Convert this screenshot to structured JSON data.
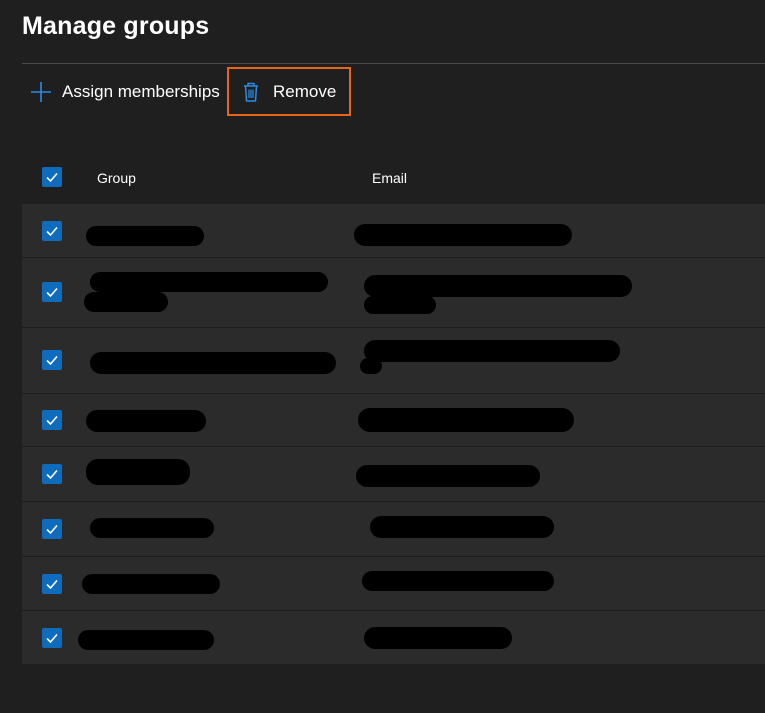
{
  "page": {
    "title": "Manage groups"
  },
  "toolbar": {
    "assign_label": "Assign memberships",
    "remove_label": "Remove"
  },
  "table": {
    "columns": {
      "group": "Group",
      "email": "Email"
    },
    "header_checked": true,
    "rows": [
      {
        "checked": true,
        "group": "",
        "email": ""
      },
      {
        "checked": true,
        "group": "",
        "email": ""
      },
      {
        "checked": true,
        "group": "",
        "email": ""
      },
      {
        "checked": true,
        "group": "",
        "email": ""
      },
      {
        "checked": true,
        "group": "",
        "email": ""
      },
      {
        "checked": true,
        "group": "",
        "email": ""
      },
      {
        "checked": true,
        "group": "",
        "email": ""
      },
      {
        "checked": true,
        "group": "",
        "email": ""
      }
    ]
  },
  "colors": {
    "accent": "#0f6cbd",
    "highlight_border": "#e8651c",
    "background": "#1f1f1f",
    "row_background": "#2b2b2b"
  },
  "icons": {
    "assign": "plus-icon",
    "remove": "trash-icon",
    "check": "checkmark-icon"
  }
}
